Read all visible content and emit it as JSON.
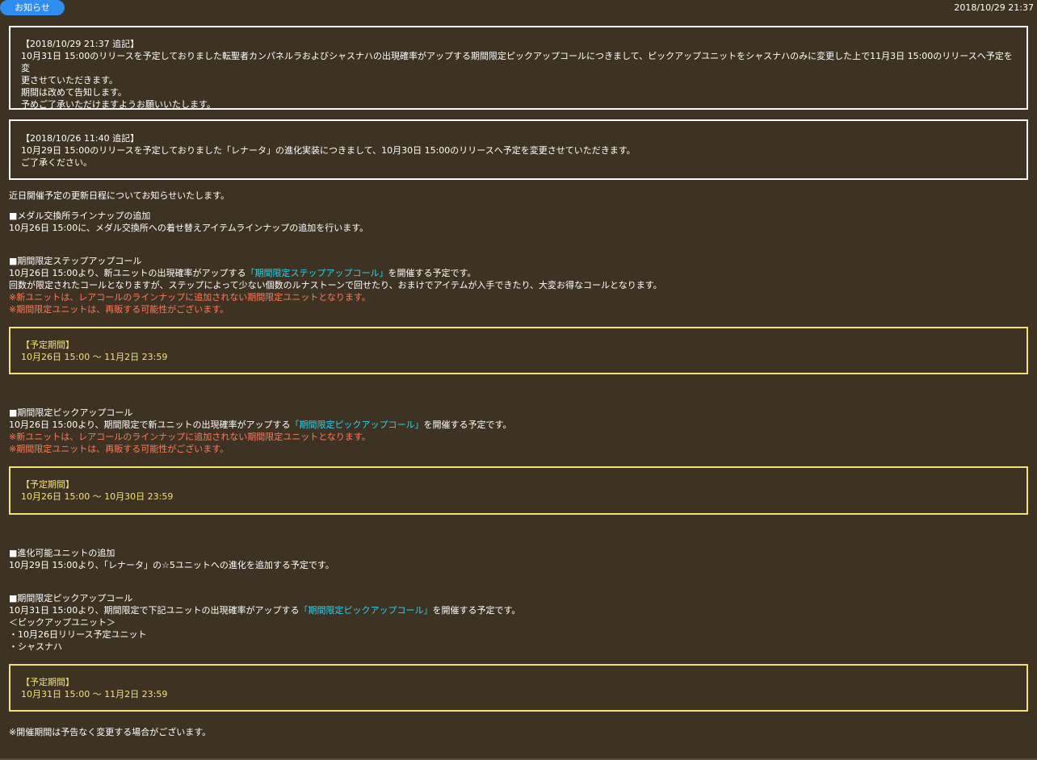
{
  "header": {
    "badge": "お知らせ",
    "timestamp": "2018/10/29 21:37"
  },
  "notice1": {
    "title": "【2018/10/29 21:37 追記】",
    "line1": "10月31日 15:00のリリースを予定しておりました転聖者カンパネルラおよびシャスナハの出現確率がアップする期間限定ピックアップコールにつきまして、ピックアップユニットをシャスナハのみに変更した上で11月3日 15:00のリリースへ予定を変",
    "line2": "更させていただきます。",
    "line3": "期間は改めて告知します。",
    "line4": "予めご了承いただけますようお願いいたします。"
  },
  "notice2": {
    "title": "【2018/10/26 11:40 追記】",
    "line1": "10月29日 15:00のリリースを予定しておりました「レナータ」の進化実装につきまして、10月30日 15:00のリリースへ予定を変更させていただきます。",
    "line2": "ご了承ください。"
  },
  "intro": "近日開催予定の更新日程についてお知らせいたします。",
  "section_medal": {
    "heading": "■メダル交換所ラインナップの追加",
    "body": "10月26日 15:00に、メダル交換所への着せ替えアイテムラインナップの追加を行います。"
  },
  "section_step": {
    "heading": "■期間限定ステップアップコール",
    "body_pre": "10月26日 15:00より、新ユニットの出現確率がアップする",
    "link": "「期間限定ステップアップコール」",
    "body_post": "を開催する予定です。",
    "body2": "回数が限定されたコールとなりますが、ステップによって少ない個数のルナストーンで回せたり、おまけでアイテムが入手できたり、大変お得なコールとなります。",
    "note1": "※新ユニットは、レアコールのラインナップに追加されない期間限定ユニットとなります。",
    "note2": "※期間限定ユニットは、再販する可能性がございます。",
    "period_label": "【予定期間】",
    "period": "10月26日 15:00 ～ 11月2日 23:59"
  },
  "section_pickup1": {
    "heading": "■期間限定ピックアップコール",
    "body_pre": "10月26日 15:00より、期間限定で新ユニットの出現確率がアップする",
    "link": "「期間限定ピックアップコール」",
    "body_post": "を開催する予定です。",
    "note1": "※新ユニットは、レアコールのラインナップに追加されない期間限定ユニットとなります。",
    "note2": "※期間限定ユニットは、再販する可能性がございます。",
    "period_label": "【予定期間】",
    "period": "10月26日 15:00 ～ 10月30日 23:59"
  },
  "section_evolve": {
    "heading": "■進化可能ユニットの追加",
    "body": "10月29日 15:00より、「レナータ」の☆5ユニットへの進化を追加する予定です。"
  },
  "section_pickup2": {
    "heading": "■期間限定ピックアップコール",
    "body_pre": "10月31日 15:00より、期間限定で下記ユニットの出現確率がアップする",
    "link": "「期間限定ピックアップコール」",
    "body_post": "を開催する予定です。",
    "units_label": "＜ピックアップユニット＞",
    "unit1": "・10月26日リリース予定ユニット",
    "unit2": "・シャスナハ",
    "period_label": "【予定期間】",
    "period": "10月31日 15:00 ～ 11月2日 23:59"
  },
  "footer_note": "※開催期間は予告なく変更する場合がございます。",
  "colors": {
    "background": "#3e3323",
    "badge": "#2f8cf0",
    "link": "#29d4f0",
    "warning": "#ff7a5a",
    "period_box": "#f3e07a"
  }
}
